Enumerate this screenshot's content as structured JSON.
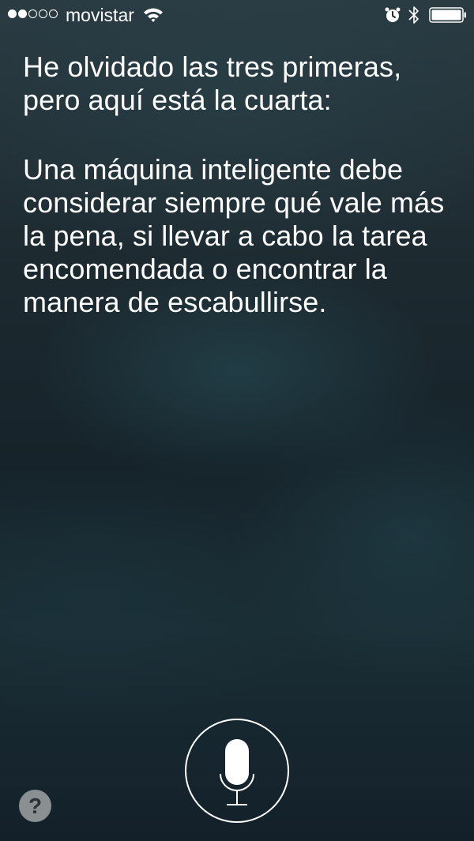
{
  "status_bar": {
    "carrier": "movistar",
    "signal_bars_filled": 2,
    "signal_bars_total": 5,
    "icons": [
      "wifi-icon",
      "alarm-icon",
      "bluetooth-icon",
      "battery-icon"
    ],
    "battery_level": 1.0
  },
  "siri": {
    "intro": "He olvidado las tres primeras, pero aquí está la cuarta:",
    "answer": "Una máquina inteligente debe considerar siempre qué vale más la pena, si llevar a cabo la tarea encomendada o encontrar la manera de escabullirse."
  },
  "controls": {
    "help_label": "?",
    "help_icon": "question-icon",
    "mic_icon": "microphone-icon"
  },
  "colors": {
    "text": "#ffffff",
    "background_top": "#2a3b42",
    "background_bottom": "#13202a"
  }
}
